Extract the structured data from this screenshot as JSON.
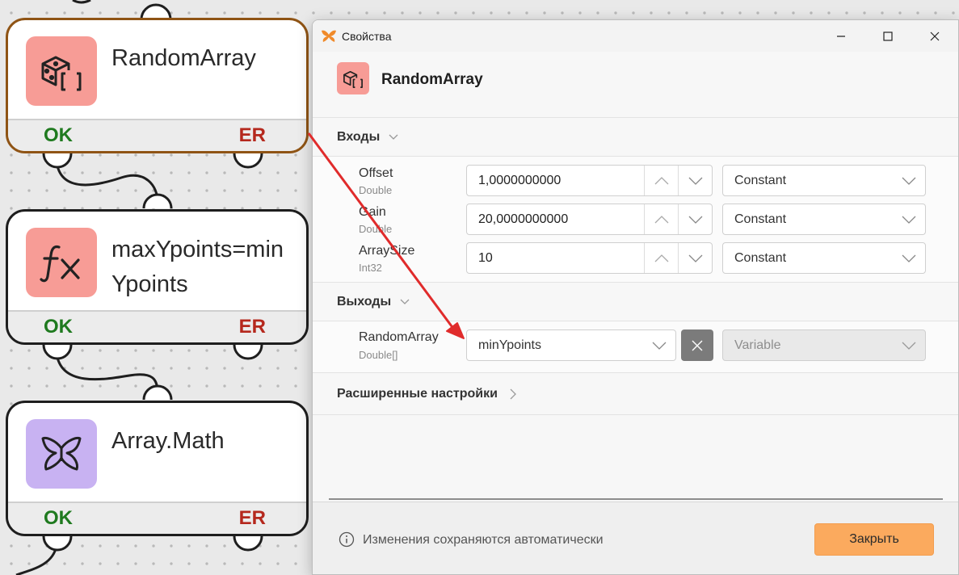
{
  "canvas": {
    "nodes": [
      {
        "title": "RandomArray",
        "icon": "dice-array-icon",
        "ok": "OK",
        "er": "ER"
      },
      {
        "title": "maxYpoints=minYpoints",
        "icon": "function-fx-icon",
        "ok": "OK",
        "er": "ER"
      },
      {
        "title": "Array.Math",
        "icon": "butterfly-icon",
        "ok": "OK",
        "er": "ER"
      }
    ]
  },
  "dialog": {
    "window_title": "Свойства",
    "block_name": "RandomArray",
    "inputs_header": "Входы",
    "inputs": [
      {
        "name": "Offset",
        "type": "Double",
        "value": "1,0000000000",
        "mode": "Constant"
      },
      {
        "name": "Gain",
        "type": "Double",
        "value": "20,0000000000",
        "mode": "Constant"
      },
      {
        "name": "ArraySize",
        "type": "Int32",
        "value": "10",
        "mode": "Constant"
      }
    ],
    "outputs_header": "Выходы",
    "outputs": [
      {
        "name": "RandomArray",
        "type": "Double[]",
        "value": "minYpoints",
        "mode": "Variable"
      }
    ],
    "advanced_header": "Расширенные настройки",
    "footer_info": "Изменения сохраняются автоматически",
    "close_label": "Закрыть"
  },
  "colors": {
    "accent": "#fbaa5e",
    "selected_border": "#8f5415",
    "ok_green": "#1f7a1f",
    "er_red": "#b5281d",
    "annotation_arrow": "#e02b2b"
  }
}
